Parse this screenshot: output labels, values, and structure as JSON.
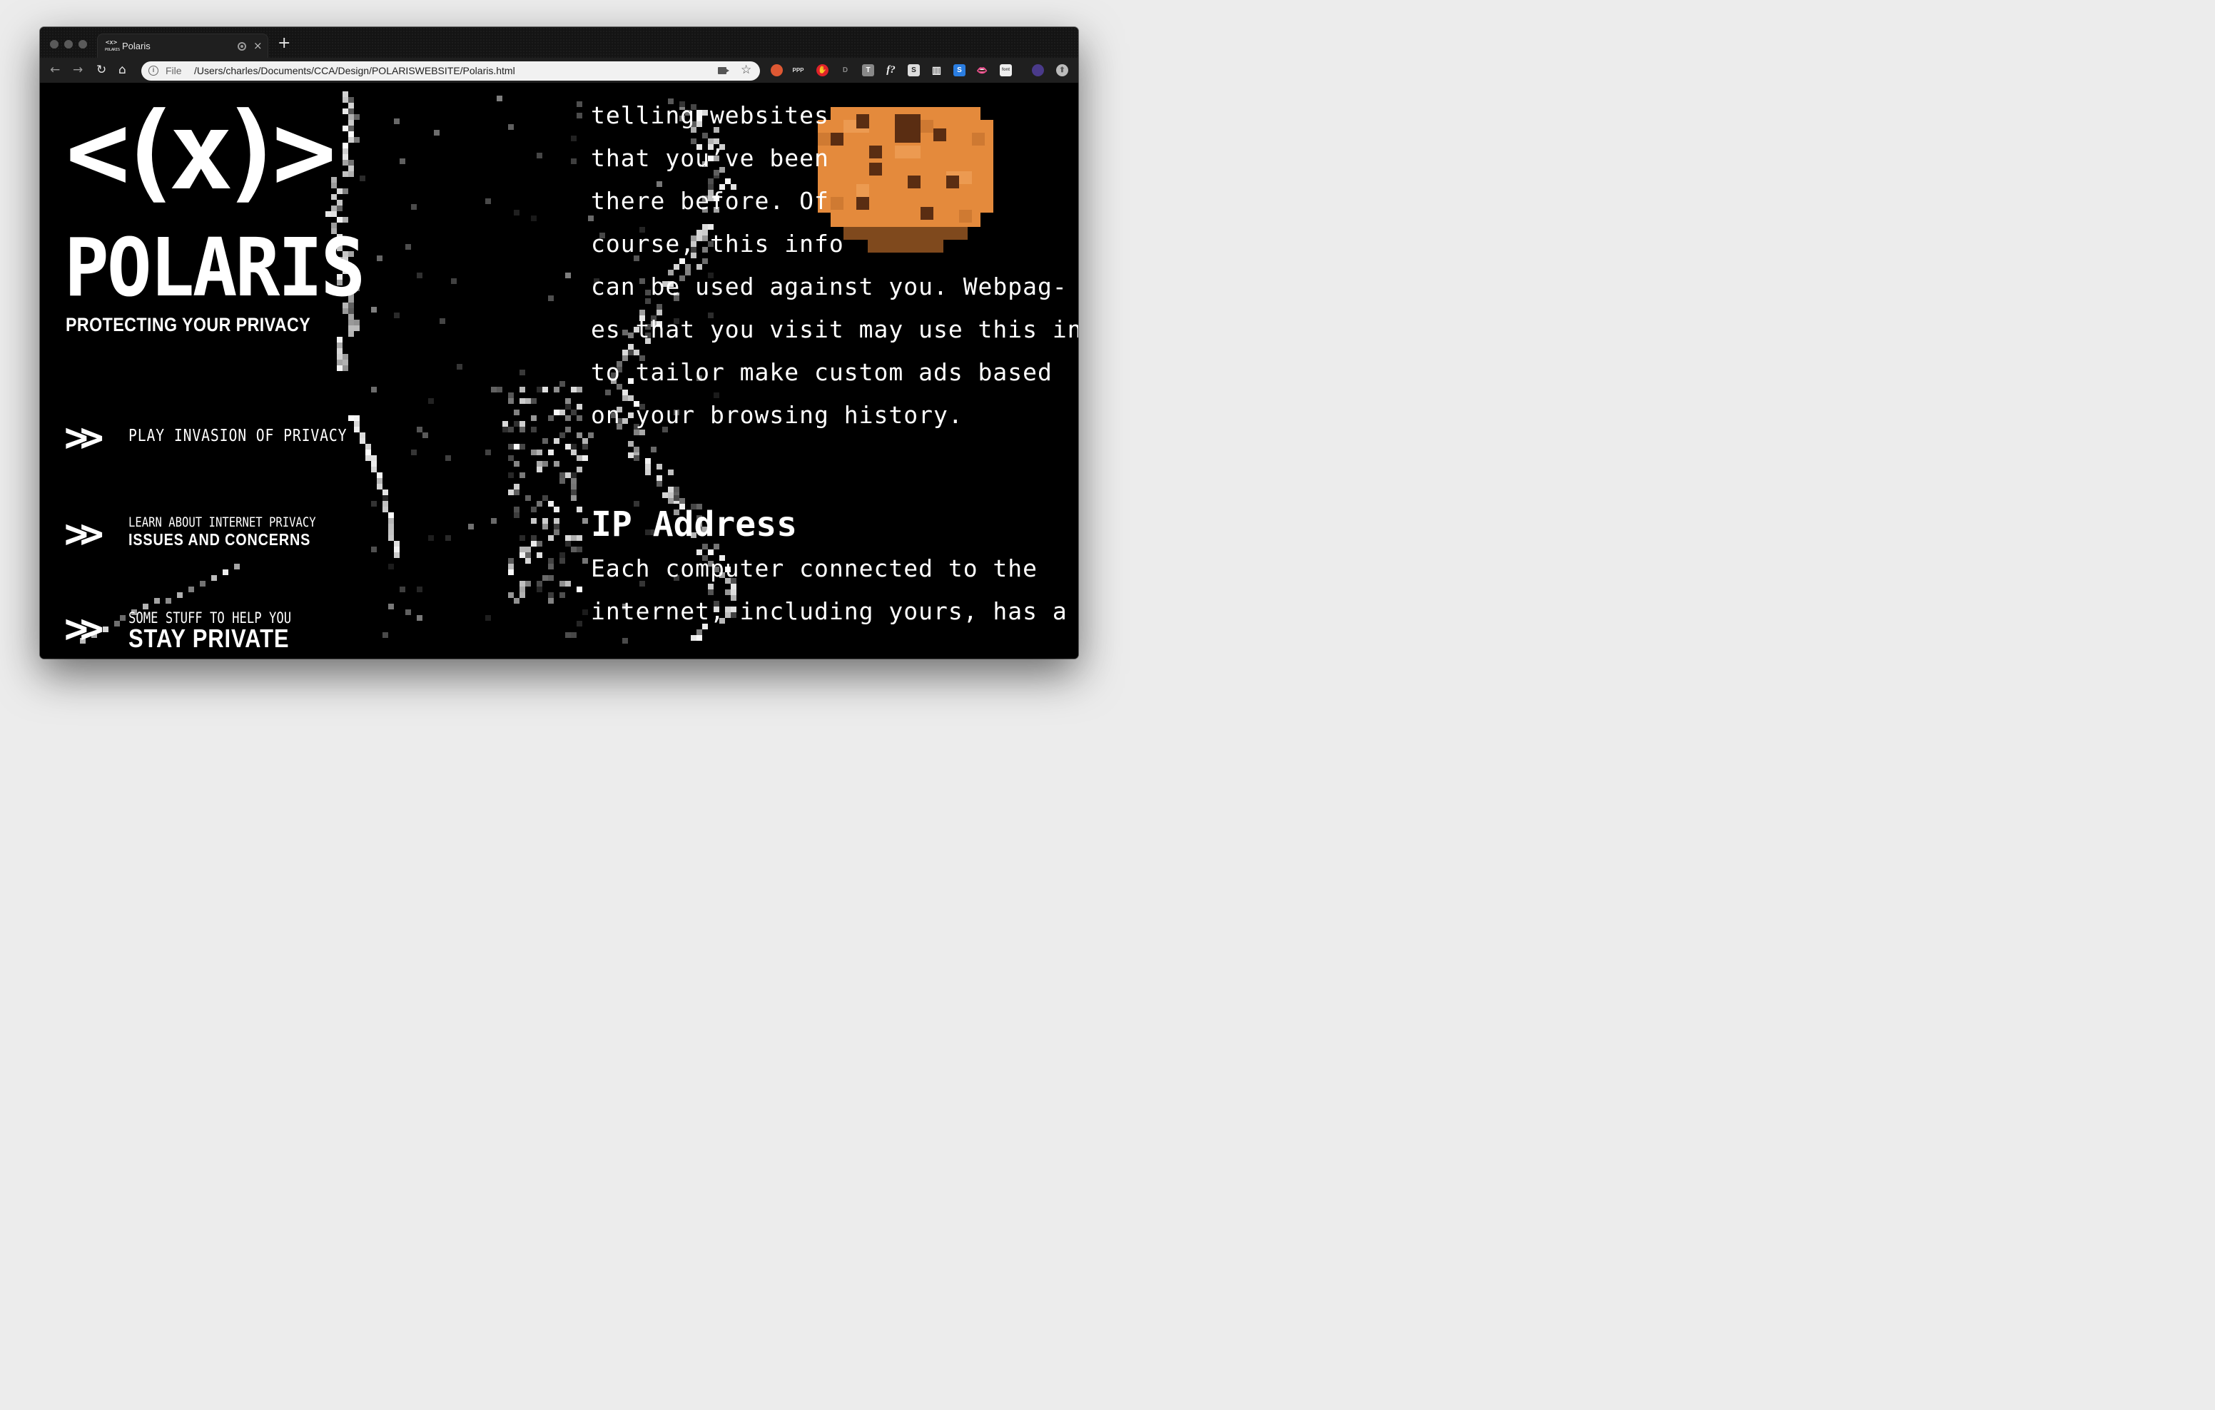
{
  "browser": {
    "tab_title": "Polaris",
    "tab_favicon_text": "POLARIS",
    "new_tab_label": "+",
    "close_label": "×",
    "omnibox_scheme": "File",
    "omnibox_url": "/Users/charles/Documents/CCA/Design/POLARISWEBSITE/Polaris.html",
    "extensions": [
      "duckduckgo-icon",
      "ppp-icon",
      "adblock-icon",
      "extension-d-icon",
      "text-t-icon",
      "whatfont-icon",
      "s-icon",
      "reader-icon",
      "s-blue-icon",
      "lips-icon",
      "ext-box-icon",
      "avatar-icon",
      "menu-icon"
    ]
  },
  "site": {
    "logo_symbol": "<(x)>",
    "title": "POLARIS",
    "tagline": "PROTECTING YOUR PRIVACY",
    "menu": [
      {
        "big": "PLAY INVASION OF PRIVACY",
        "small": ""
      },
      {
        "small": "LEARN ABOUT INTERNET PRIVACY",
        "big": "ISSUES AND CONCERNS"
      },
      {
        "small": "SOME STUFF TO HELP YOU",
        "big": "STAY PRIVATE"
      }
    ],
    "chevron_glyph": ">>"
  },
  "article": {
    "cookie_lines": [
      "telling  websites",
      "that  you’ve  been",
      "there  before.  Of",
      "course,  this  info"
    ],
    "wide_lines": [
      "can be used against you. Webpag-",
      "es that you visit may use this info",
      "to tailor make custom ads based",
      "on your browsing history."
    ],
    "ip_heading": "IP Address",
    "ip_lines": [
      "Each  computer  connected  to  the",
      "internet,  including  yours,  has  a"
    ]
  },
  "colors": {
    "background": "#000000",
    "text": "#ffffff",
    "cookie_base": "#e48a3c",
    "cookie_chip": "#5a2d12"
  }
}
